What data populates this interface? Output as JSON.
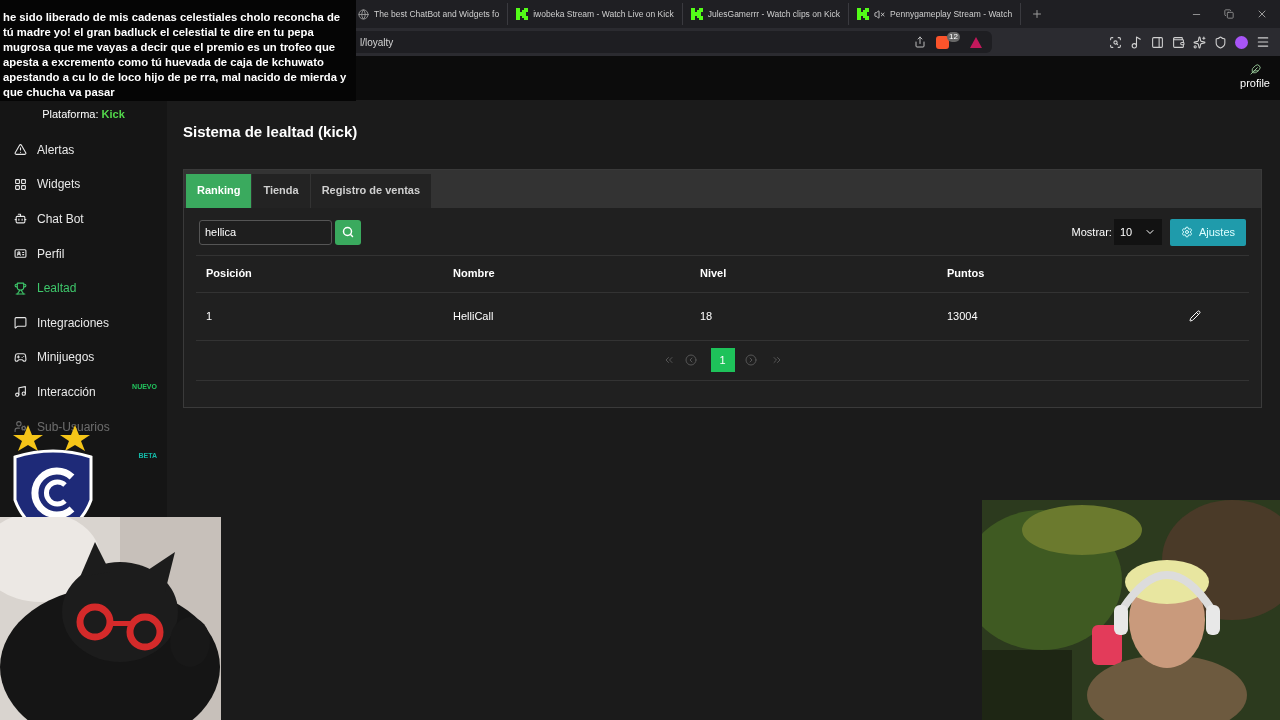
{
  "browser": {
    "tabs": [
      {
        "title": "The best ChatBot and Widgets fo",
        "kind": "globe"
      },
      {
        "title": "iwobeka Stream - Watch Live on Kick",
        "kind": "kick"
      },
      {
        "title": "JulesGamerrr - Watch clips on Kick",
        "kind": "kick"
      },
      {
        "title": "Pennygameplay Stream - Watch",
        "kind": "kick_muted"
      }
    ],
    "address": "l/loyalty",
    "shield_count": "12"
  },
  "chat_overlay": {
    "message": "he sido liberado de mis cadenas celestiales cholo reconcha de tú madre yo! el gran badluck el celestial te dire en tu pepa mugrosa que me vayas a decir que el premio es un trofeo que apesta a excremento como tú huevada de caja de kchuwato apestando a cu lo de loco hijo de pe rra, mal nacido de mierda y que chucha va pasar"
  },
  "header": {
    "profile": "profile"
  },
  "sidebar": {
    "platform_label": "Plataforma:",
    "platform": "Kick",
    "items": [
      {
        "label": "Alertas",
        "selected": false,
        "disabled": false
      },
      {
        "label": "Widgets",
        "selected": false,
        "disabled": false
      },
      {
        "label": "Chat Bot",
        "selected": false,
        "disabled": false
      },
      {
        "label": "Perfil",
        "selected": false,
        "disabled": false
      },
      {
        "label": "Lealtad",
        "selected": true,
        "disabled": false
      },
      {
        "label": "Integraciones",
        "selected": false,
        "disabled": false
      },
      {
        "label": "Minijuegos",
        "selected": false,
        "disabled": false
      },
      {
        "label": "Interacción",
        "selected": false,
        "disabled": false,
        "badge": "NUEVO",
        "color": "#22c55e"
      },
      {
        "label": "Sub-Usuarios",
        "selected": false,
        "disabled": true
      }
    ],
    "covered_item": {
      "badge": "BETA",
      "color": "#14b8a6"
    }
  },
  "page": {
    "title": "Sistema de lealtad (kick)",
    "tabs": [
      {
        "label": "Ranking",
        "selected": true
      },
      {
        "label": "Tienda",
        "selected": false
      },
      {
        "label": "Registro de ventas",
        "selected": false
      }
    ],
    "search": {
      "value": "hellica"
    },
    "show": {
      "label": "Mostrar:",
      "value": "10"
    },
    "settings_button": "Ajustes",
    "table": {
      "columns": [
        "Posición",
        "Nombre",
        "Nivel",
        "Puntos"
      ],
      "rows": [
        {
          "cells": [
            "1",
            "HelliCall",
            "18",
            "13004"
          ]
        }
      ]
    },
    "pagination": {
      "pages": [
        {
          "label": "1",
          "selected": true
        }
      ]
    }
  }
}
